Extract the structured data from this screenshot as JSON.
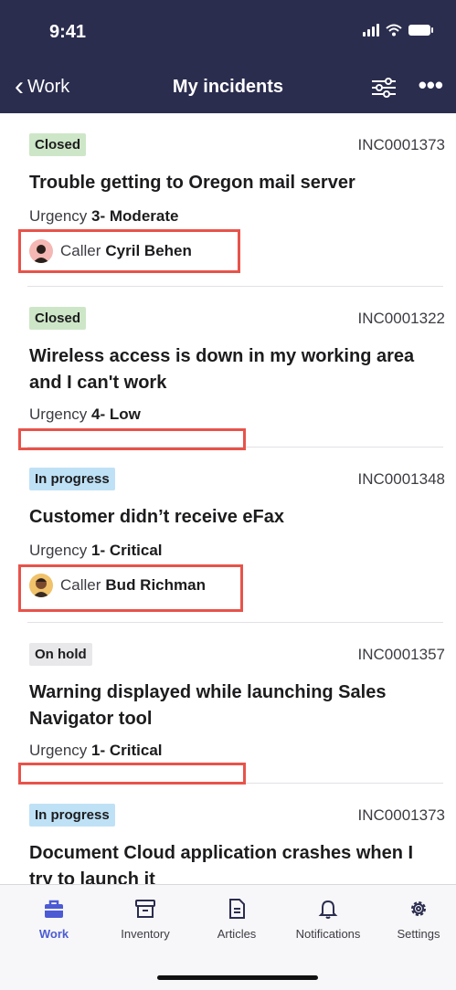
{
  "status": {
    "time": "9:41"
  },
  "nav": {
    "back_label": "Work",
    "title": "My incidents"
  },
  "incidents": [
    {
      "state": "Closed",
      "number": "INC0001373",
      "title": "Trouble getting to Oregon mail server",
      "urgency_label": "Urgency",
      "urgency": "3- Moderate",
      "caller_label": "Caller",
      "caller": "Cyril Behen"
    },
    {
      "state": "Closed",
      "number": "INC0001322",
      "title": "Wireless access is down in my working area and I can't work",
      "urgency_label": "Urgency",
      "urgency": "4- Low"
    },
    {
      "state": "In progress",
      "number": "INC0001348",
      "title": "Customer didn’t receive eFax",
      "urgency_label": "Urgency",
      "urgency": "1- Critical",
      "caller_label": "Caller",
      "caller": "Bud Richman"
    },
    {
      "state": "On hold",
      "number": "INC0001357",
      "title": "Warning displayed while launching Sales Navigator tool",
      "urgency_label": "Urgency",
      "urgency": "1- Critical"
    },
    {
      "state": "In progress",
      "number": "INC0001373",
      "title": "Document Cloud application crashes when I try to launch it"
    }
  ],
  "tabs": [
    {
      "label": "Work",
      "icon": "briefcase-icon",
      "active": true
    },
    {
      "label": "Inventory",
      "icon": "archive-box-icon"
    },
    {
      "label": "Articles",
      "icon": "document-icon"
    },
    {
      "label": "Notifications",
      "icon": "bell-icon"
    },
    {
      "label": "Settings",
      "icon": "gear-icon"
    }
  ],
  "colors": {
    "header": "#2b2d4f",
    "accent": "#4c5bd4",
    "highlight": "#e8534a",
    "closed_badge": "#cde6c7",
    "progress_badge": "#bfe1f6",
    "hold_badge": "#e8e8ea"
  }
}
